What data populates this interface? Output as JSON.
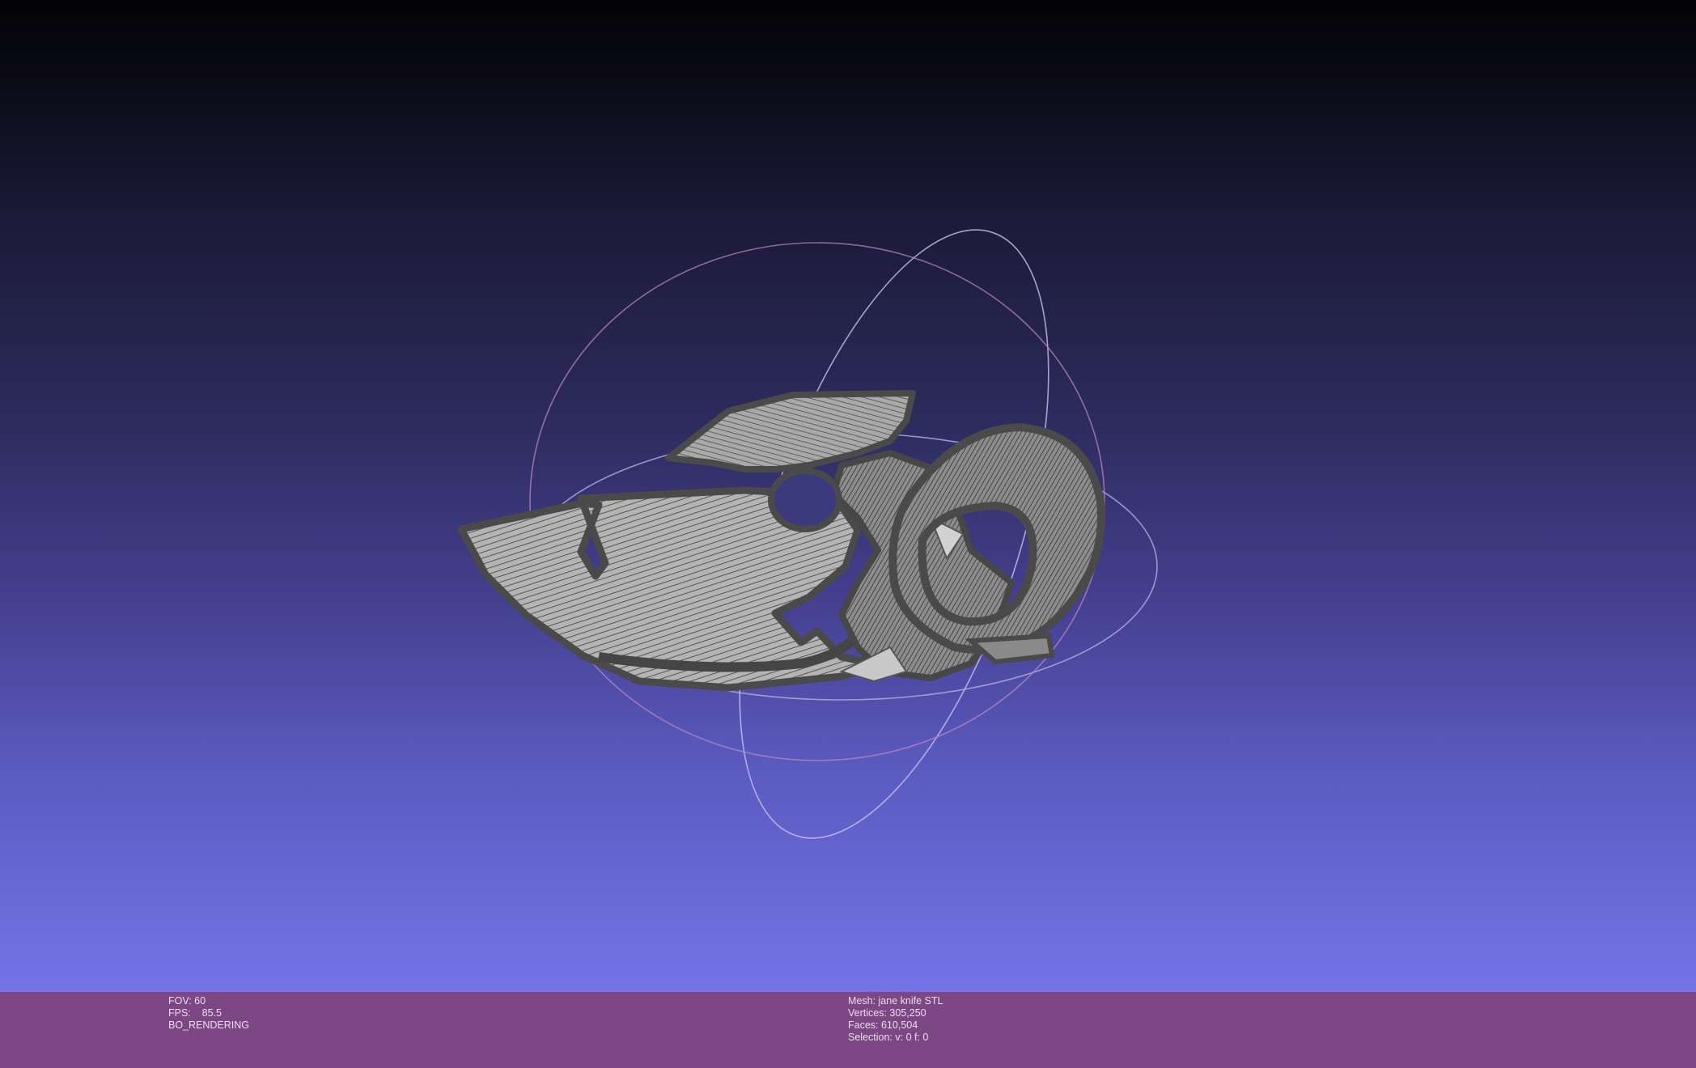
{
  "viewer": {
    "colors": {
      "background_top": "#020204",
      "background_bottom": "#7474e8",
      "info_bar": "#7d4684",
      "mesh_fill": "#a6a6a6",
      "mesh_edge": "#4a4a4a",
      "trackball_x": "#a67fb7",
      "trackball_y": "#b4b4e6",
      "trackball_z": "#8fb0b0"
    },
    "icons": {
      "model": "mesh-model",
      "trackball": "trackball-rings"
    }
  },
  "info_left": {
    "fov": "FOV: 60",
    "fps": "FPS:    85.5",
    "mode": "BO_RENDERING"
  },
  "info_right": {
    "mesh": "Mesh: jane knife STL",
    "vertices": "Vertices: 305,250",
    "faces": "Faces: 610,504",
    "selection": "Selection: v: 0 f: 0"
  }
}
